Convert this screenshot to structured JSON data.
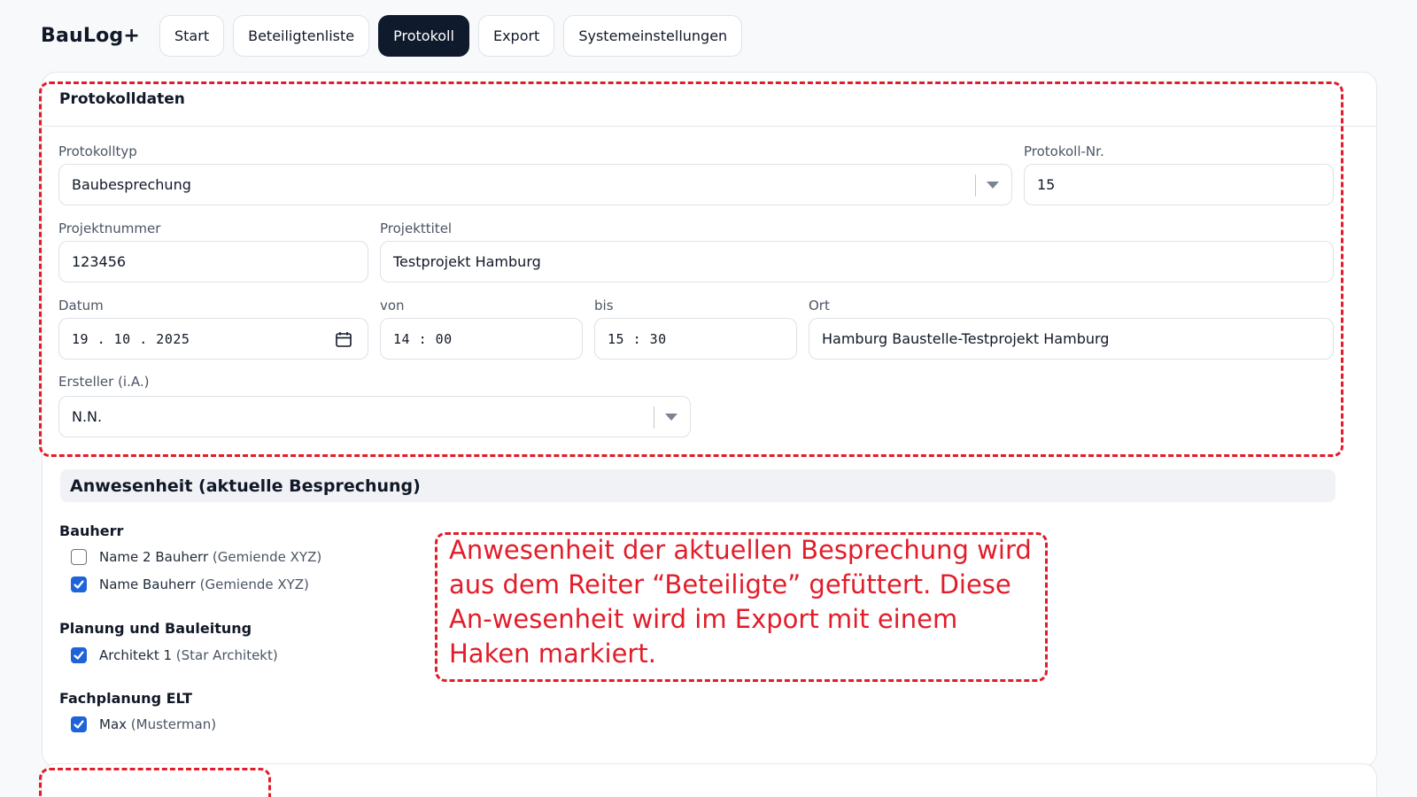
{
  "app": {
    "title": "BauLog+"
  },
  "nav": {
    "tabs": [
      {
        "label": "Start"
      },
      {
        "label": "Beteiligtenliste"
      },
      {
        "label": "Protokoll"
      },
      {
        "label": "Export"
      },
      {
        "label": "Systemeinstellungen"
      }
    ],
    "active": "Protokoll"
  },
  "protocol": {
    "header": "Protokolldaten",
    "type_label": "Protokolltyp",
    "type_value": "Baubesprechung",
    "nr_label": "Protokoll-Nr.",
    "nr_value": "15",
    "project_number_label": "Projektnummer",
    "project_number_value": "123456",
    "project_title_label": "Projekttitel",
    "project_title_value": "Testprojekt Hamburg",
    "date_label": "Datum",
    "date_value": "19 . 10 . 2025",
    "from_label": "von",
    "from_value": "14 : 00",
    "to_label": "bis",
    "to_value": "15 : 30",
    "location_label": "Ort",
    "location_value": "Hamburg Baustelle-Testprojekt Hamburg",
    "author_label": "Ersteller (i.A.)",
    "author_value": "N.N."
  },
  "attendance": {
    "title": "Anwesenheit (aktuelle Besprechung)",
    "groups": [
      {
        "name": "Bauherr",
        "people": [
          {
            "name": "Name 2 Bauherr",
            "org": "(Gemiende XYZ)",
            "checked": false
          },
          {
            "name": "Name Bauherr",
            "org": "(Gemiende XYZ)",
            "checked": true
          }
        ]
      },
      {
        "name": "Planung und Bauleitung",
        "people": [
          {
            "name": "Architekt 1",
            "org": "(Star Architekt)",
            "checked": true
          }
        ]
      },
      {
        "name": "Fachplanung ELT",
        "people": [
          {
            "name": "Max",
            "org": "(Musterman)",
            "checked": true
          }
        ]
      }
    ]
  },
  "annotation": {
    "text": "Anwesenheit der aktuellen Besprechung wird aus dem Reiter “Beteiligte” gefüttert. Diese An-wesenheit wird im Export mit einem Haken markiert."
  },
  "colors": {
    "accent": "#1e63d8",
    "nav_active": "#0f1b2d",
    "annotation": "#e11d2a"
  }
}
